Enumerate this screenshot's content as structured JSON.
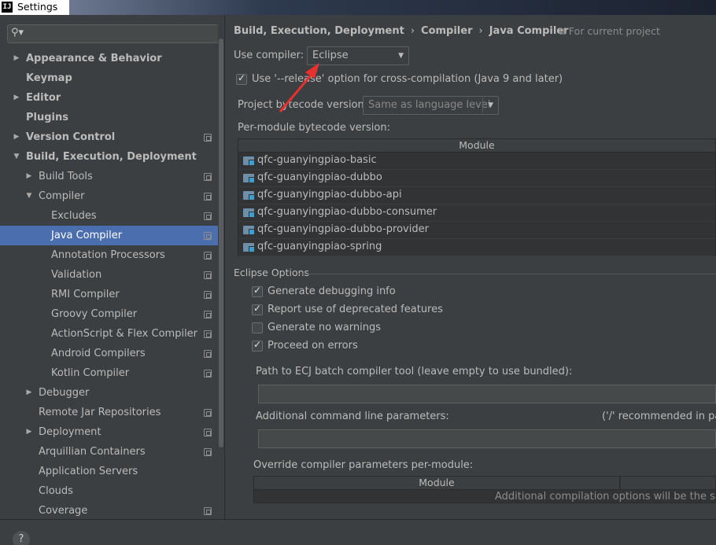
{
  "window": {
    "title": "Settings",
    "app_icon": "IJ"
  },
  "sidebar": {
    "search_placeholder": "",
    "items": [
      {
        "label": "Appearance & Behavior",
        "bold": true,
        "level": 0,
        "arrow": "right",
        "proj": false
      },
      {
        "label": "Keymap",
        "bold": true,
        "level": 0,
        "arrow": "",
        "proj": false
      },
      {
        "label": "Editor",
        "bold": true,
        "level": 0,
        "arrow": "right",
        "proj": false
      },
      {
        "label": "Plugins",
        "bold": true,
        "level": 0,
        "arrow": "",
        "proj": false
      },
      {
        "label": "Version Control",
        "bold": true,
        "level": 0,
        "arrow": "right",
        "proj": true
      },
      {
        "label": "Build, Execution, Deployment",
        "bold": true,
        "level": 0,
        "arrow": "down",
        "proj": false
      },
      {
        "label": "Build Tools",
        "bold": false,
        "level": 1,
        "arrow": "right",
        "proj": true
      },
      {
        "label": "Compiler",
        "bold": false,
        "level": 1,
        "arrow": "down",
        "proj": true
      },
      {
        "label": "Excludes",
        "bold": false,
        "level": 2,
        "arrow": "",
        "proj": true
      },
      {
        "label": "Java Compiler",
        "bold": false,
        "level": 2,
        "arrow": "",
        "proj": true,
        "selected": true
      },
      {
        "label": "Annotation Processors",
        "bold": false,
        "level": 2,
        "arrow": "",
        "proj": true
      },
      {
        "label": "Validation",
        "bold": false,
        "level": 2,
        "arrow": "",
        "proj": true
      },
      {
        "label": "RMI Compiler",
        "bold": false,
        "level": 2,
        "arrow": "",
        "proj": true
      },
      {
        "label": "Groovy Compiler",
        "bold": false,
        "level": 2,
        "arrow": "",
        "proj": true
      },
      {
        "label": "ActionScript & Flex Compiler",
        "bold": false,
        "level": 2,
        "arrow": "",
        "proj": true
      },
      {
        "label": "Android Compilers",
        "bold": false,
        "level": 2,
        "arrow": "",
        "proj": true
      },
      {
        "label": "Kotlin Compiler",
        "bold": false,
        "level": 2,
        "arrow": "",
        "proj": true
      },
      {
        "label": "Debugger",
        "bold": false,
        "level": 1,
        "arrow": "right",
        "proj": false
      },
      {
        "label": "Remote Jar Repositories",
        "bold": false,
        "level": 1,
        "arrow": "",
        "proj": true
      },
      {
        "label": "Deployment",
        "bold": false,
        "level": 1,
        "arrow": "right",
        "proj": true
      },
      {
        "label": "Arquillian Containers",
        "bold": false,
        "level": 1,
        "arrow": "",
        "proj": true
      },
      {
        "label": "Application Servers",
        "bold": false,
        "level": 1,
        "arrow": "",
        "proj": false
      },
      {
        "label": "Clouds",
        "bold": false,
        "level": 1,
        "arrow": "",
        "proj": false
      },
      {
        "label": "Coverage",
        "bold": false,
        "level": 1,
        "arrow": "",
        "proj": true
      }
    ]
  },
  "main": {
    "breadcrumb": [
      "Build, Execution, Deployment",
      "Compiler",
      "Java Compiler"
    ],
    "breadcrumb_sep": "›",
    "for_project": "For current project",
    "use_compiler_label": "Use compiler:",
    "use_compiler_value": "Eclipse",
    "release_option_label": "Use '--release' option for cross-compilation (Java 9 and later)",
    "bytecode_label": "Project bytecode version:",
    "bytecode_value": "Same as language level",
    "per_module_label": "Per-module bytecode version:",
    "module_header": "Module",
    "modules": [
      "qfc-guanyingpiao-basic",
      "qfc-guanyingpiao-dubbo",
      "qfc-guanyingpiao-dubbo-api",
      "qfc-guanyingpiao-dubbo-consumer",
      "qfc-guanyingpiao-dubbo-provider",
      "qfc-guanyingpiao-spring"
    ],
    "eclipse_options_title": "Eclipse Options",
    "options": [
      {
        "label": "Generate debugging info",
        "checked": true
      },
      {
        "label": "Report use of deprecated features",
        "checked": true
      },
      {
        "label": "Generate no warnings",
        "checked": false
      },
      {
        "label": "Proceed on errors",
        "checked": true
      }
    ],
    "ecj_path_label": "Path to ECJ batch compiler tool (leave empty to use bundled):",
    "additional_params_label": "Additional command line parameters:",
    "recommended_hint": "('/' recommended in path",
    "override_label": "Override compiler parameters per-module:",
    "override_module_header": "Module",
    "override_hint": "Additional compilation options will be the same"
  },
  "footer": {
    "help_label": "?"
  },
  "colors": {
    "selection": "#4b6eaf",
    "background": "#3c3f41",
    "annotation_arrow": "#e8312f"
  }
}
